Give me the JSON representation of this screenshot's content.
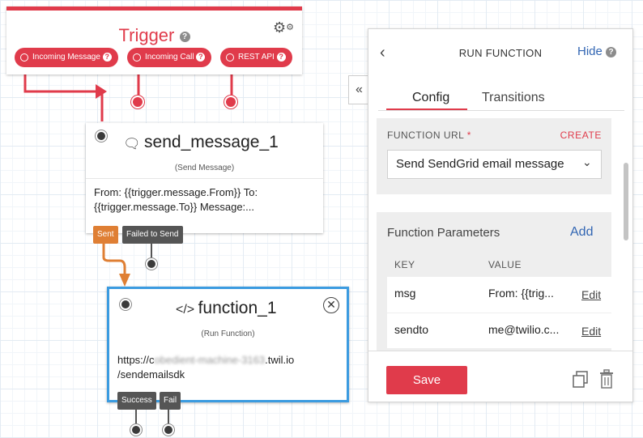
{
  "trigger": {
    "title": "Trigger",
    "help": "?",
    "gear_icon": "gear-icon",
    "pills": [
      {
        "label": "Incoming Message"
      },
      {
        "label": "Incoming Call"
      },
      {
        "label": "REST API"
      }
    ]
  },
  "send_message": {
    "icon": "chat-icon",
    "title": "send_message_1",
    "subtitle": "(Send Message)",
    "body": "From: {{trigger.message.From}} To: {{trigger.message.To}} Message:...",
    "transitions": [
      "Sent",
      "Failed to Send"
    ]
  },
  "function_node": {
    "icon": "code-icon",
    "title": "function_1",
    "subtitle": "(Run Function)",
    "url_prefix": "https://c",
    "url_hidden": "obedient-machine-3163",
    "url_suffix": ".twil.io",
    "url_path": "/sendemailsdk",
    "transitions": [
      "Success",
      "Fail"
    ]
  },
  "panel": {
    "title": "RUN FUNCTION",
    "hide": "Hide",
    "collapse": "«",
    "tabs": [
      {
        "label": "Config",
        "active": true
      },
      {
        "label": "Transitions",
        "active": false
      }
    ],
    "function_url": {
      "label": "FUNCTION URL",
      "required_mark": "*",
      "create": "CREATE",
      "selected": "Send SendGrid email message"
    },
    "params": {
      "title": "Function Parameters",
      "add": "Add",
      "headers": [
        "KEY",
        "VALUE"
      ],
      "rows": [
        {
          "key": "msg",
          "value": "From: {{trig...",
          "action": "Edit"
        },
        {
          "key": "sendto",
          "value": "me@twilio.c...",
          "action": "Edit"
        }
      ]
    },
    "save": "Save"
  },
  "colors": {
    "accent": "#e03b4b",
    "link": "#3266b3",
    "selected_border": "#3b9be0",
    "sent_tag": "#df7f34"
  }
}
